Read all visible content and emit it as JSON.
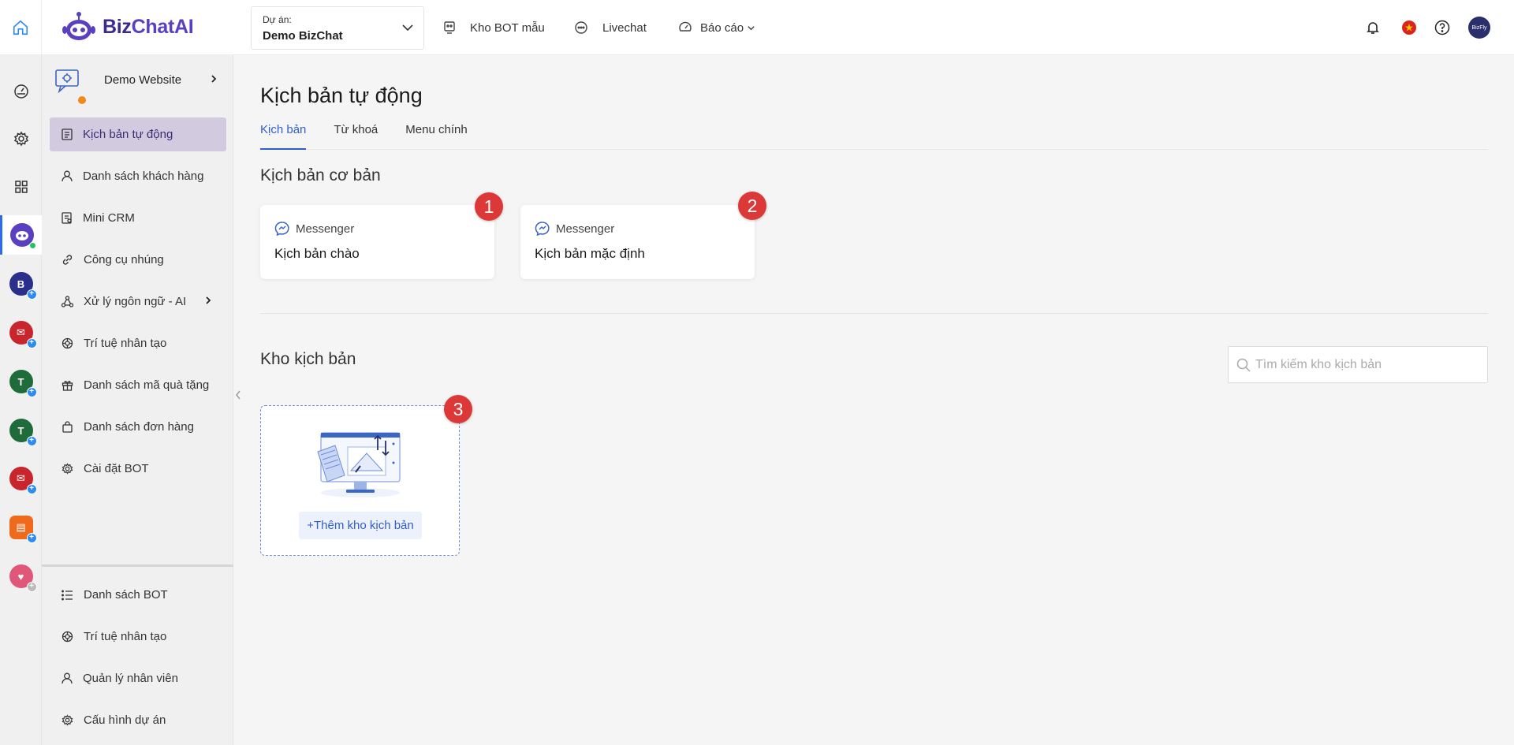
{
  "brand": {
    "part1": "Biz",
    "part2": "ChatAI"
  },
  "project": {
    "label": "Dự án:",
    "value": "Demo BizChat"
  },
  "top_nav": {
    "bot_store": "Kho BOT mẫu",
    "livechat": "Livechat",
    "reports": "Báo cáo"
  },
  "header_right": {
    "avatar_text": "BizFly"
  },
  "bot": {
    "name": "Demo Website"
  },
  "sidebar": {
    "items": [
      {
        "label": "Kịch bản tự động"
      },
      {
        "label": "Danh sách khách hàng"
      },
      {
        "label": "Mini CRM"
      },
      {
        "label": "Công cụ nhúng"
      },
      {
        "label": "Xử lý ngôn ngữ - AI"
      },
      {
        "label": "Trí tuệ nhân tạo"
      },
      {
        "label": "Danh sách mã quà tặng"
      },
      {
        "label": "Danh sách đơn hàng"
      },
      {
        "label": "Cài đặt BOT"
      }
    ],
    "bottom_items": [
      {
        "label": "Danh sách BOT"
      },
      {
        "label": "Trí tuệ nhân tạo"
      },
      {
        "label": "Quản lý nhân viên"
      },
      {
        "label": "Cấu hình dự án"
      }
    ]
  },
  "main": {
    "title": "Kịch bản tự động",
    "tabs": [
      {
        "label": "Kịch bản"
      },
      {
        "label": "Từ khoá"
      },
      {
        "label": "Menu chính"
      }
    ],
    "basic_section": "Kịch bản cơ bản",
    "cards": [
      {
        "channel": "Messenger",
        "title": "Kịch bản chào",
        "badge": "1"
      },
      {
        "channel": "Messenger",
        "title": "Kịch bản mặc định",
        "badge": "2"
      }
    ],
    "store_section": "Kho kịch bản",
    "search_placeholder": "Tìm kiếm kho kịch bản",
    "add_button": "+Thêm kho kịch bản",
    "add_badge": "3"
  },
  "colors": {
    "accent": "#2d5fd0",
    "brand": "#3d2a8c",
    "badge": "#dc3838",
    "active_menu": "#d2cbe0"
  }
}
